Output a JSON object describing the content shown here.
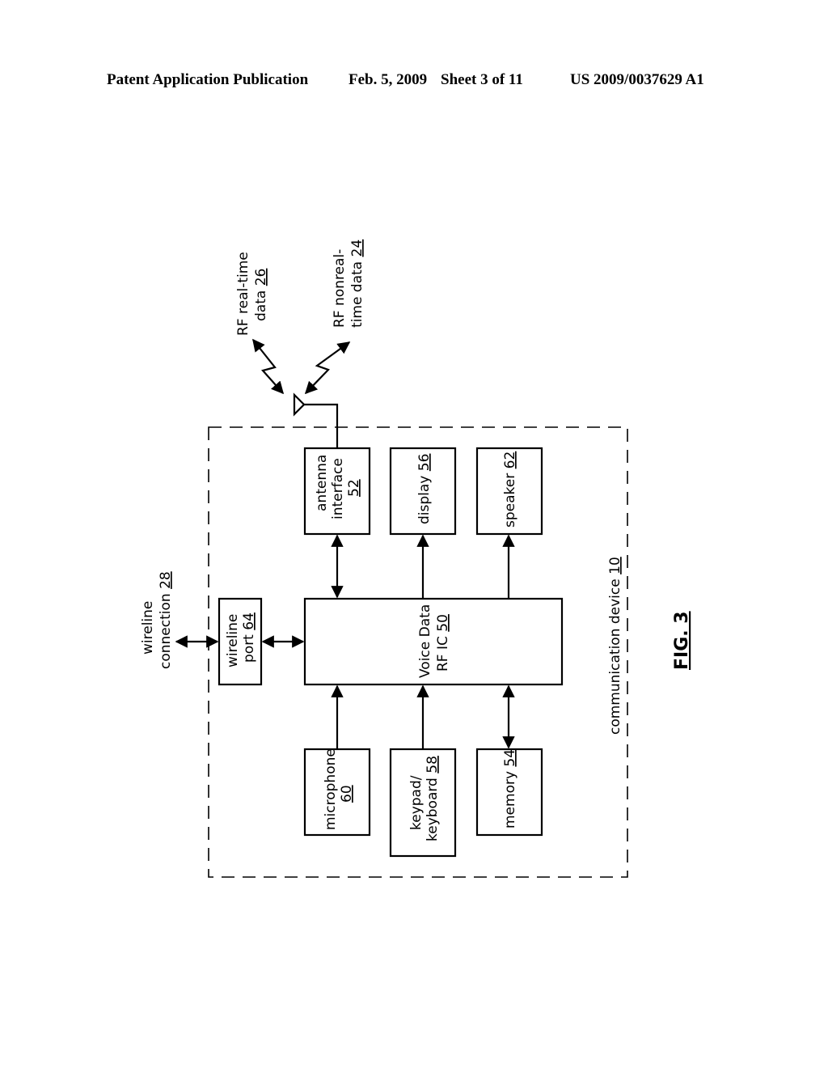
{
  "header": {
    "publication": "Patent Application Publication",
    "date": "Feb. 5, 2009",
    "sheet": "Sheet 3 of 11",
    "number": "US 2009/0037629 A1"
  },
  "figure": {
    "label": "FIG. 3",
    "container": {
      "label": "communication device",
      "ref": "10"
    },
    "external": {
      "rf_realtime": {
        "line1": "RF real-time",
        "line2": "data",
        "ref": "26"
      },
      "rf_nonrealtime": {
        "line1": "RF nonreal-",
        "line2": "time data",
        "ref": "24"
      },
      "wireline_connection": {
        "line1": "wireline",
        "line2": "connection",
        "ref": "28"
      }
    },
    "blocks": {
      "antenna_interface": {
        "line1": "antenna",
        "line2": "interface",
        "ref": "52"
      },
      "display": {
        "label": "display",
        "ref": "56"
      },
      "speaker": {
        "label": "speaker",
        "ref": "62"
      },
      "wireline_port": {
        "line1": "wireline",
        "line2": "port",
        "ref": "64"
      },
      "rf_ic": {
        "line1": "Voice Data",
        "line2": "RF IC",
        "ref": "50"
      },
      "microphone": {
        "label": "microphone",
        "ref": "60"
      },
      "keypad": {
        "line1": "keypad/",
        "line2": "keyboard",
        "ref": "58"
      },
      "memory": {
        "label": "memory",
        "ref": "54"
      }
    }
  }
}
